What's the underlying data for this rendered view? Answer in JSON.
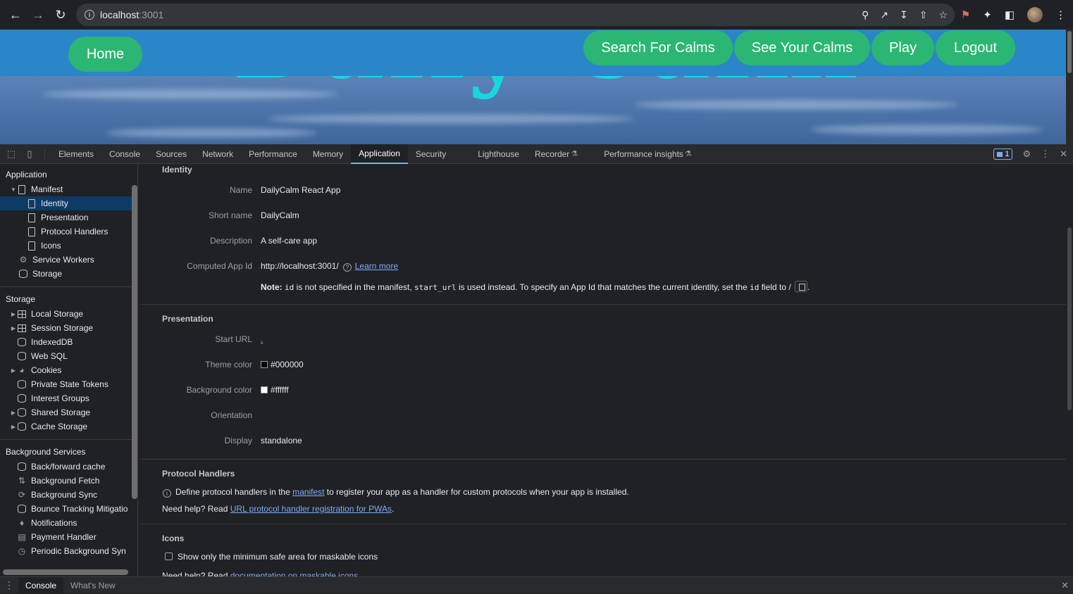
{
  "browser": {
    "url_host": "localhost",
    "url_port": ":3001"
  },
  "site": {
    "nav": {
      "home": "Home",
      "search": "Search For Calms",
      "see": "See Your Calms",
      "play": "Play",
      "logout": "Logout"
    },
    "hero_title": "Daily Calm"
  },
  "devtools": {
    "tabs": [
      "Elements",
      "Console",
      "Sources",
      "Network",
      "Performance",
      "Memory",
      "Application",
      "Security",
      "Lighthouse",
      "Recorder",
      "Performance insights"
    ],
    "active_tab": "Application",
    "issues_count": "1",
    "sidebar": {
      "application_header": "Application",
      "manifest": "Manifest",
      "manifest_children": [
        "Identity",
        "Presentation",
        "Protocol Handlers",
        "Icons"
      ],
      "service_workers": "Service Workers",
      "storage_item": "Storage",
      "storage_header": "Storage",
      "storage_items": [
        "Local Storage",
        "Session Storage",
        "IndexedDB",
        "Web SQL",
        "Cookies",
        "Private State Tokens",
        "Interest Groups",
        "Shared Storage",
        "Cache Storage"
      ],
      "bg_header": "Background Services",
      "bg_items": [
        "Back/forward cache",
        "Background Fetch",
        "Background Sync",
        "Bounce Tracking Mitigatio",
        "Notifications",
        "Payment Handler",
        "Periodic Background Syn"
      ]
    },
    "identity": {
      "title": "Identity",
      "name_label": "Name",
      "name": "DailyCalm React App",
      "short_name_label": "Short name",
      "short_name": "DailyCalm",
      "description_label": "Description",
      "description": "A self-care app",
      "app_id_label": "Computed App Id",
      "app_id": "http://localhost:3001/",
      "learn_more": "Learn more",
      "note_bold": "Note:",
      "note_code_id": "id",
      "note_text1": " is not specified in the manifest, ",
      "note_code_start": "start_url",
      "note_text2": " is used instead. To specify an App Id that matches the current identity, set the ",
      "note_text3": " field to /",
      "note_end": "."
    },
    "presentation": {
      "title": "Presentation",
      "start_url_label": "Start URL",
      "start_url": ".",
      "theme_label": "Theme color",
      "theme": "#000000",
      "bg_label": "Background color",
      "bg": "#ffffff",
      "orientation_label": "Orientation",
      "orientation": "",
      "display_label": "Display",
      "display": "standalone"
    },
    "protocol": {
      "title": "Protocol Handlers",
      "define_text1": "Define protocol handlers in the ",
      "manifest_link": "manifest",
      "define_text2": " to register your app as a handler for custom protocols when your app is installed.",
      "help_text": "Need help? Read ",
      "help_link": "URL protocol handler registration for PWAs",
      "help_end": "."
    },
    "icons": {
      "title": "Icons",
      "checkbox_label": "Show only the minimum safe area for maskable icons",
      "help_text": "Need help? Read ",
      "help_link": "documentation on maskable icons"
    },
    "drawer": {
      "console": "Console",
      "whats_new": "What's New"
    }
  },
  "colors": {
    "nav_bg": "#2a86c9",
    "pill": "#2bb673",
    "hero": "#18d6e0",
    "link": "#7cacf8"
  }
}
